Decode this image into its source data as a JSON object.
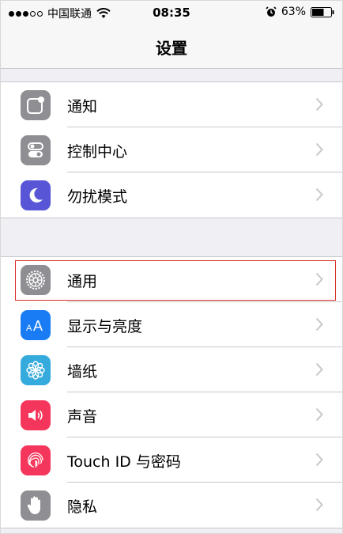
{
  "status_bar": {
    "signal_bars": 3,
    "signal_max": 5,
    "carrier": "中国联通",
    "wifi_icon": "wifi-icon",
    "time": "08:35",
    "alarm_icon": "alarm-clock-icon",
    "battery_percent_text": "63%",
    "battery_level": 0.63
  },
  "nav": {
    "title": "设置"
  },
  "group1": [
    {
      "label": "通知",
      "icon": "notifications-icon",
      "color": "#8e8e93"
    },
    {
      "label": "控制中心",
      "icon": "control-center-icon",
      "color": "#8e8e93"
    },
    {
      "label": "勿扰模式",
      "icon": "do-not-disturb-moon-icon",
      "color": "#5856d6"
    }
  ],
  "group2": [
    {
      "label": "通用",
      "icon": "gear-icon",
      "color": "#8e8e93",
      "highlighted": true
    },
    {
      "label": "显示与亮度",
      "icon": "display-brightness-icon",
      "color": "#1a7cf5"
    },
    {
      "label": "墙纸",
      "icon": "wallpaper-flower-icon",
      "color": "#35aadc"
    },
    {
      "label": "声音",
      "icon": "sounds-speaker-icon",
      "color": "#f5365c"
    },
    {
      "label": "Touch ID 与密码",
      "icon": "fingerprint-icon",
      "color": "#f5365c"
    },
    {
      "label": "隐私",
      "icon": "privacy-hand-icon",
      "color": "#8e8e93"
    }
  ]
}
